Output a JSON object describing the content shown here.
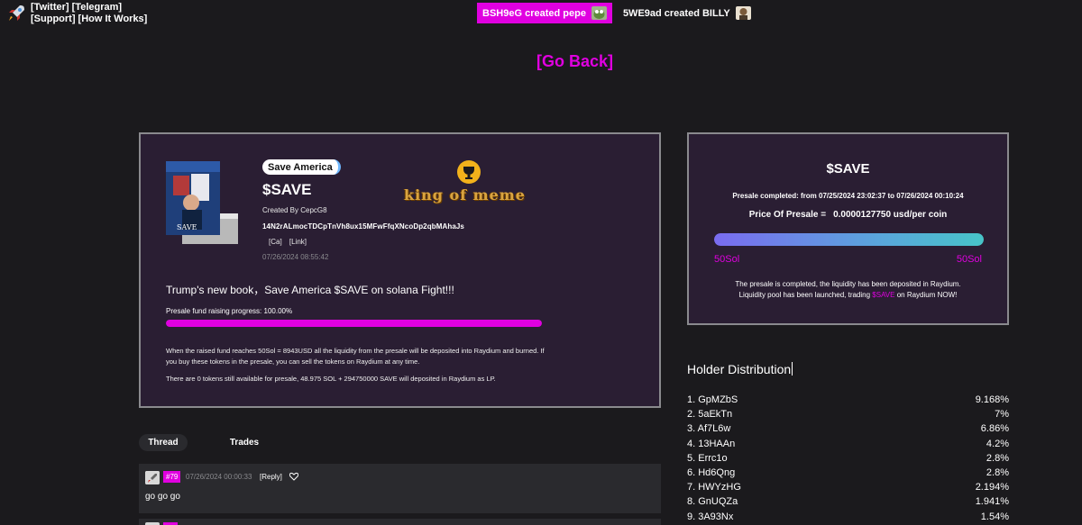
{
  "topbar": {
    "twitter": "[Twitter]",
    "telegram": "[Telegram]",
    "support": "[Support]",
    "how_it_works": "[How It Works]"
  },
  "ticker": [
    {
      "text": "BSH9eG  created pepe",
      "highlight": true
    },
    {
      "text": "5WE9ad  created BILLY",
      "highlight": false
    }
  ],
  "go_back": "[Go Back]",
  "token": {
    "name_badge": "Save America",
    "symbol": "$SAVE",
    "created_by": "Created By CepcG8",
    "address": "14N2rALmocTDCpTnVh8ux15MFwFfqXNcoDp2qbMAhaJs",
    "ca_link": "[Ca]",
    "link": "[Link]",
    "timestamp": "07/26/2024 08:55:42",
    "king_label": "king of meme",
    "description": "Trump's new book，Save America $SAVE on solana Fight!!!",
    "progress_label": "Presale fund raising progress: 100.00%",
    "progress_fraction": 1.0,
    "info_text": "When the raised fund reaches 50Sol = 8943USD all the liquidity from the presale will be deposited into Raydium and burned. If you buy these tokens in the presale, you can sell the tokens on Raydium at any time.",
    "remaining_text": "There are 0 tokens still available for presale, 48.975 SOL + 294750000 SAVE will deposited in Raydium as LP."
  },
  "presale": {
    "symbol": "$SAVE",
    "completed": "Presale completed: from 07/25/2024 23:02:37 to 07/26/2024 00:10:24",
    "price_label": "Price Of Presale =",
    "price_value": "0.0000127750 usd/per coin",
    "progress_fraction": 1.0,
    "min_label": "50Sol",
    "max_label": "50Sol",
    "note_line1": "The presale is completed, the liquidity has been deposited in Raydium.",
    "note_line2_a": "Liquidity pool has been launched, trading ",
    "note_line2_b": "$SAVE",
    "note_line2_c": " on Raydium NOW!"
  },
  "holders": {
    "title": "Holder Distribution",
    "rows": [
      {
        "name": "1. GpMZbS",
        "pct": "9.168%"
      },
      {
        "name": "2. 5aEkTn",
        "pct": "7%"
      },
      {
        "name": "3. Af7L6w",
        "pct": "6.86%"
      },
      {
        "name": "4. 13HAAn",
        "pct": "4.2%"
      },
      {
        "name": "5. Errc1o",
        "pct": "2.8%"
      },
      {
        "name": "6. Hd6Qng",
        "pct": "2.8%"
      },
      {
        "name": "7. HWYzHG",
        "pct": "2.194%"
      },
      {
        "name": "8. GnUQZa",
        "pct": "1.941%"
      },
      {
        "name": "9. 3A93Nx",
        "pct": "1.54%"
      }
    ]
  },
  "tabs": {
    "thread": "Thread",
    "trades": "Trades"
  },
  "post": {
    "number": "#79",
    "timestamp": "07/26/2024 00:00:33",
    "reply": "[Reply]",
    "message": "go go go"
  },
  "colors": {
    "accent": "#e000e0",
    "card_bg": "#2a1e33",
    "page_bg": "#1b1a1d"
  }
}
